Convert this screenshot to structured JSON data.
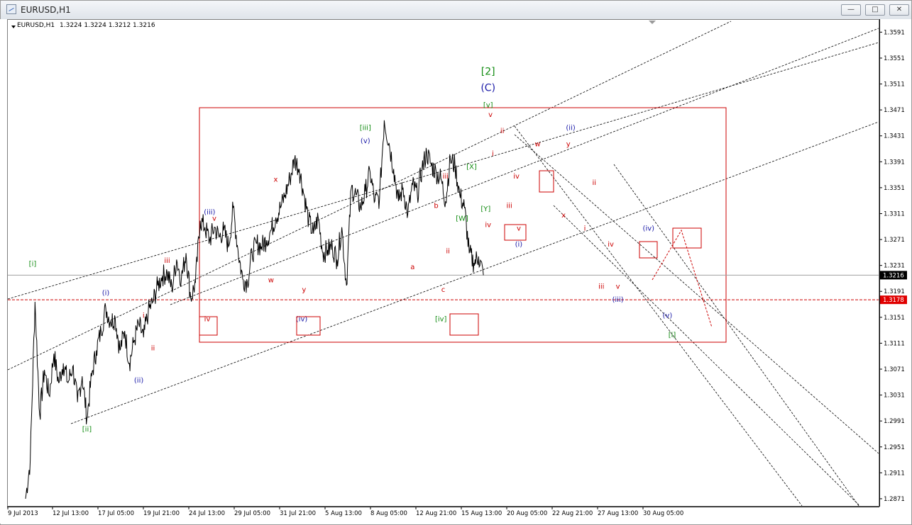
{
  "window": {
    "title": "EURUSD,H1",
    "buttons": [
      "minimize",
      "restore",
      "close"
    ]
  },
  "header": {
    "symbol": "EURUSD,H1",
    "ohlc": "1.3224 1.3224 1.3212 1.3216"
  },
  "chart_data": {
    "type": "line",
    "symbol": "EURUSD",
    "timeframe": "H1",
    "y_ticks": [
      "1.3591",
      "1.3551",
      "1.3511",
      "1.3471",
      "1.3431",
      "1.3391",
      "1.3351",
      "1.3311",
      "1.3271",
      "1.3231",
      "1.3191",
      "1.3151",
      "1.3111",
      "1.3071",
      "1.3031",
      "1.2991",
      "1.2951",
      "1.2911",
      "1.2871"
    ],
    "ylim": [
      1.286,
      1.361
    ],
    "x_ticks": [
      "9 Jul 2013",
      "12 Jul 13:00",
      "17 Jul 05:00",
      "19 Jul 21:00",
      "24 Jul 13:00",
      "29 Jul 05:00",
      "31 Jul 21:00",
      "5 Aug 13:00",
      "8 Aug 05:00",
      "12 Aug 21:00",
      "15 Aug 13:00",
      "20 Aug 05:00",
      "22 Aug 21:00",
      "27 Aug 13:00",
      "30 Aug 05:00"
    ],
    "current_price": "1.3216",
    "marked_price": "1.3178",
    "colors": {
      "price": "#000000",
      "red": "#cc0000",
      "blue": "#1a1aa8",
      "green": "#128c12",
      "current_tag": "#000000",
      "marked_tag": "#e00000"
    },
    "series": [
      {
        "values": [
          [
            0,
            1.2871
          ],
          [
            1,
            1.293
          ],
          [
            2,
            1.3175
          ],
          [
            3,
            1.3
          ],
          [
            4,
            1.307
          ],
          [
            5,
            1.303
          ],
          [
            6,
            1.3095
          ],
          [
            7,
            1.305
          ],
          [
            8,
            1.308
          ],
          [
            9,
            1.305
          ],
          [
            10,
            1.3075
          ],
          [
            11,
            1.302
          ],
          [
            12,
            1.306
          ],
          [
            13,
            1.2995
          ],
          [
            14,
            1.306
          ],
          [
            15,
            1.31
          ],
          [
            16,
            1.313
          ],
          [
            17,
            1.3165
          ],
          [
            18,
            1.3145
          ],
          [
            19,
            1.315
          ],
          [
            20,
            1.31
          ],
          [
            21,
            1.313
          ],
          [
            22,
            1.308
          ],
          [
            23,
            1.3115
          ],
          [
            24,
            1.314
          ],
          [
            25,
            1.312
          ],
          [
            26,
            1.316
          ],
          [
            27,
            1.3175
          ],
          [
            28,
            1.32
          ],
          [
            29,
            1.3215
          ],
          [
            30,
            1.322
          ],
          [
            31,
            1.3195
          ],
          [
            32,
            1.324
          ],
          [
            33,
            1.321
          ],
          [
            34,
            1.325
          ],
          [
            35,
            1.318
          ],
          [
            36,
            1.3205
          ],
          [
            37,
            1.33
          ],
          [
            38,
            1.329
          ],
          [
            39,
            1.327
          ],
          [
            40,
            1.329
          ],
          [
            41,
            1.3275
          ],
          [
            42,
            1.3285
          ],
          [
            43,
            1.326
          ],
          [
            44,
            1.332
          ],
          [
            45,
            1.3255
          ],
          [
            46,
            1.321
          ],
          [
            47,
            1.3205
          ],
          [
            48,
            1.325
          ],
          [
            49,
            1.3265
          ],
          [
            50,
            1.326
          ],
          [
            51,
            1.327
          ],
          [
            52,
            1.3285
          ],
          [
            53,
            1.3305
          ],
          [
            54,
            1.332
          ],
          [
            55,
            1.334
          ],
          [
            56,
            1.3365
          ],
          [
            57,
            1.3395
          ],
          [
            58,
            1.338
          ],
          [
            59,
            1.334
          ],
          [
            60,
            1.33
          ],
          [
            61,
            1.328
          ],
          [
            62,
            1.3305
          ],
          [
            63,
            1.325
          ],
          [
            64,
            1.3255
          ],
          [
            65,
            1.326
          ],
          [
            66,
            1.324
          ],
          [
            67,
            1.329
          ],
          [
            68,
            1.32
          ],
          [
            69,
            1.335
          ],
          [
            70,
            1.334
          ],
          [
            71,
            1.332
          ],
          [
            72,
            1.3345
          ],
          [
            73,
            1.3375
          ],
          [
            74,
            1.333
          ],
          [
            75,
            1.3335
          ],
          [
            76,
            1.3455
          ],
          [
            77,
            1.342
          ],
          [
            78,
            1.338
          ],
          [
            79,
            1.333
          ],
          [
            80,
            1.335
          ],
          [
            81,
            1.331
          ],
          [
            82,
            1.3355
          ],
          [
            83,
            1.334
          ],
          [
            84,
            1.338
          ],
          [
            85,
            1.3405
          ],
          [
            86,
            1.3385
          ],
          [
            87,
            1.3375
          ],
          [
            88,
            1.3365
          ],
          [
            89,
            1.333
          ],
          [
            90,
            1.3395
          ],
          [
            91,
            1.3385
          ],
          [
            92,
            1.334
          ],
          [
            93,
            1.332
          ],
          [
            94,
            1.325
          ],
          [
            95,
            1.3235
          ],
          [
            96,
            1.3245
          ],
          [
            97,
            1.3216
          ]
        ]
      }
    ],
    "annotations": [
      {
        "text": "[i]",
        "x": 1.5,
        "y": 1.323,
        "color": "green"
      },
      {
        "text": "[ii]",
        "x": 13,
        "y": 1.2975,
        "color": "green"
      },
      {
        "text": "(i)",
        "x": 17,
        "y": 1.3185,
        "color": "blue"
      },
      {
        "text": "(ii)",
        "x": 24,
        "y": 1.305,
        "color": "blue"
      },
      {
        "text": "i",
        "x": 25,
        "y": 1.315,
        "color": "red"
      },
      {
        "text": "ii",
        "x": 27,
        "y": 1.31,
        "color": "red"
      },
      {
        "text": "iii",
        "x": 30,
        "y": 1.3235,
        "color": "red"
      },
      {
        "text": "iv",
        "x": 38.5,
        "y": 1.3145,
        "color": "red"
      },
      {
        "text": "(iii)",
        "x": 39,
        "y": 1.331,
        "color": "blue"
      },
      {
        "text": "v",
        "x": 40,
        "y": 1.33,
        "color": "red"
      },
      {
        "text": "w",
        "x": 52,
        "y": 1.3205,
        "color": "red"
      },
      {
        "text": "x",
        "x": 53,
        "y": 1.336,
        "color": "red"
      },
      {
        "text": "y",
        "x": 59,
        "y": 1.319,
        "color": "red"
      },
      {
        "text": "(iv)",
        "x": 58.5,
        "y": 1.3145,
        "color": "blue"
      },
      {
        "text": "[iii]",
        "x": 72,
        "y": 1.344,
        "color": "green"
      },
      {
        "text": "(v)",
        "x": 72,
        "y": 1.342,
        "color": "blue"
      },
      {
        "text": "a",
        "x": 82,
        "y": 1.3225,
        "color": "red"
      },
      {
        "text": "b",
        "x": 87,
        "y": 1.332,
        "color": "red"
      },
      {
        "text": "c",
        "x": 88.5,
        "y": 1.319,
        "color": "red"
      },
      {
        "text": "[iv]",
        "x": 88,
        "y": 1.3145,
        "color": "green"
      },
      {
        "text": "iii",
        "x": 89,
        "y": 1.3365,
        "color": "red"
      },
      {
        "text": "ii",
        "x": 89.5,
        "y": 1.325,
        "color": "red"
      },
      {
        "text": "[W]",
        "x": 92.5,
        "y": 1.33,
        "color": "green"
      },
      {
        "text": "[X]",
        "x": 94.5,
        "y": 1.338,
        "color": "green"
      },
      {
        "text": "[Y]",
        "x": 97.5,
        "y": 1.3315,
        "color": "green"
      },
      {
        "text": "iv",
        "x": 98,
        "y": 1.329,
        "color": "red"
      },
      {
        "text": "[2]",
        "x": 98,
        "y": 1.3525,
        "color": "green"
      },
      {
        "text": "(C)",
        "x": 98,
        "y": 1.35,
        "color": "blue"
      },
      {
        "text": "[v]",
        "x": 98,
        "y": 1.3475,
        "color": "green"
      },
      {
        "text": "v",
        "x": 98.5,
        "y": 1.346,
        "color": "red"
      },
      {
        "text": "ii",
        "x": 101,
        "y": 1.3435,
        "color": "red"
      },
      {
        "text": "i",
        "x": 99,
        "y": 1.34,
        "color": "red"
      },
      {
        "text": "iv",
        "x": 104,
        "y": 1.3365,
        "color": "red"
      },
      {
        "text": "iii",
        "x": 102.5,
        "y": 1.332,
        "color": "red"
      },
      {
        "text": "v",
        "x": 104.5,
        "y": 1.3285,
        "color": "red"
      },
      {
        "text": "(i)",
        "x": 104.5,
        "y": 1.326,
        "color": "blue"
      },
      {
        "text": "w",
        "x": 108.5,
        "y": 1.3415,
        "color": "red"
      },
      {
        "text": "(ii)",
        "x": 115.5,
        "y": 1.344,
        "color": "blue"
      },
      {
        "text": "y",
        "x": 115,
        "y": 1.3415,
        "color": "red"
      },
      {
        "text": "x",
        "x": 114,
        "y": 1.3305,
        "color": "red"
      },
      {
        "text": "i",
        "x": 118.5,
        "y": 1.3285,
        "color": "red"
      },
      {
        "text": "ii",
        "x": 120.5,
        "y": 1.3355,
        "color": "red"
      },
      {
        "text": "iv",
        "x": 124,
        "y": 1.326,
        "color": "red"
      },
      {
        "text": "iii",
        "x": 122,
        "y": 1.3195,
        "color": "red"
      },
      {
        "text": "v",
        "x": 125.5,
        "y": 1.3195,
        "color": "red"
      },
      {
        "text": "(iii)",
        "x": 125.5,
        "y": 1.3175,
        "color": "blue"
      },
      {
        "text": "(iv)",
        "x": 132,
        "y": 1.3285,
        "color": "blue"
      },
      {
        "text": "(v)",
        "x": 136,
        "y": 1.315,
        "color": "blue"
      },
      {
        "text": "[i]",
        "x": 137,
        "y": 1.312,
        "color": "green"
      }
    ]
  }
}
